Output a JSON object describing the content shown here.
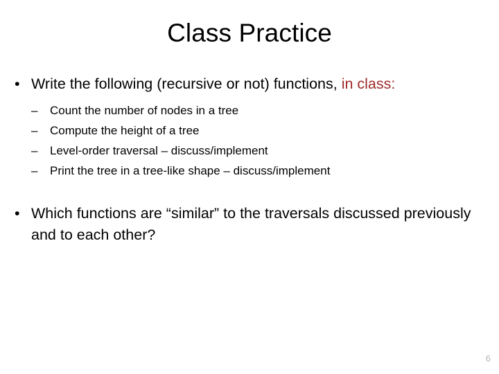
{
  "slide": {
    "title": "Class Practice",
    "page_number": "6",
    "accent_color": "#9e2a2a",
    "background_color": "#ffffff",
    "text_color": "#000000",
    "page_number_color": "#b6b6b6",
    "bullets": [
      {
        "marker": "•",
        "text_before_accent": "Write the following (recursive or not) functions, ",
        "accent_text": "in class:",
        "sub_marker": "–",
        "sub_items": [
          "Count the number of nodes in a tree",
          "Compute the height of a tree",
          "Level-order traversal – discuss/implement",
          "Print the tree in a tree-like shape – discuss/implement"
        ]
      },
      {
        "marker": "•",
        "text": "Which functions are “similar” to the traversals discussed previously and to each other?"
      }
    ]
  }
}
